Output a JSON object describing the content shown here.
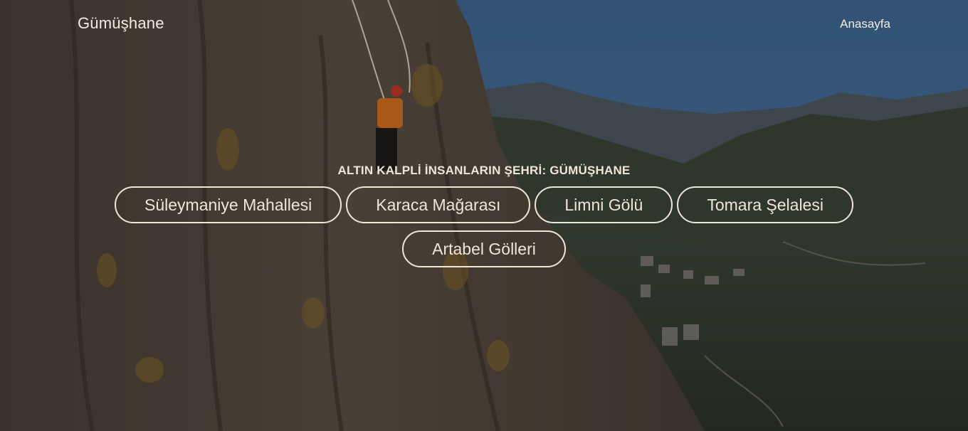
{
  "header": {
    "brand": "Gümüşhane",
    "nav_home": "Anasayfa"
  },
  "hero": {
    "headline": "ALTIN KALPLİ İNSANLARIN ŞEHRİ: GÜMÜŞHANE",
    "background": "cliff-climber-valley-photo"
  },
  "places": [
    {
      "label": "Süleymaniye Mahallesi"
    },
    {
      "label": "Karaca Mağarası"
    },
    {
      "label": "Limni Gölü"
    },
    {
      "label": "Tomara Şelalesi"
    },
    {
      "label": "Artabel Gölleri"
    }
  ],
  "colors": {
    "text": "#efe6d6",
    "overlay": "#000000",
    "sky": "#4c6f96",
    "rock": "#5a5044"
  }
}
